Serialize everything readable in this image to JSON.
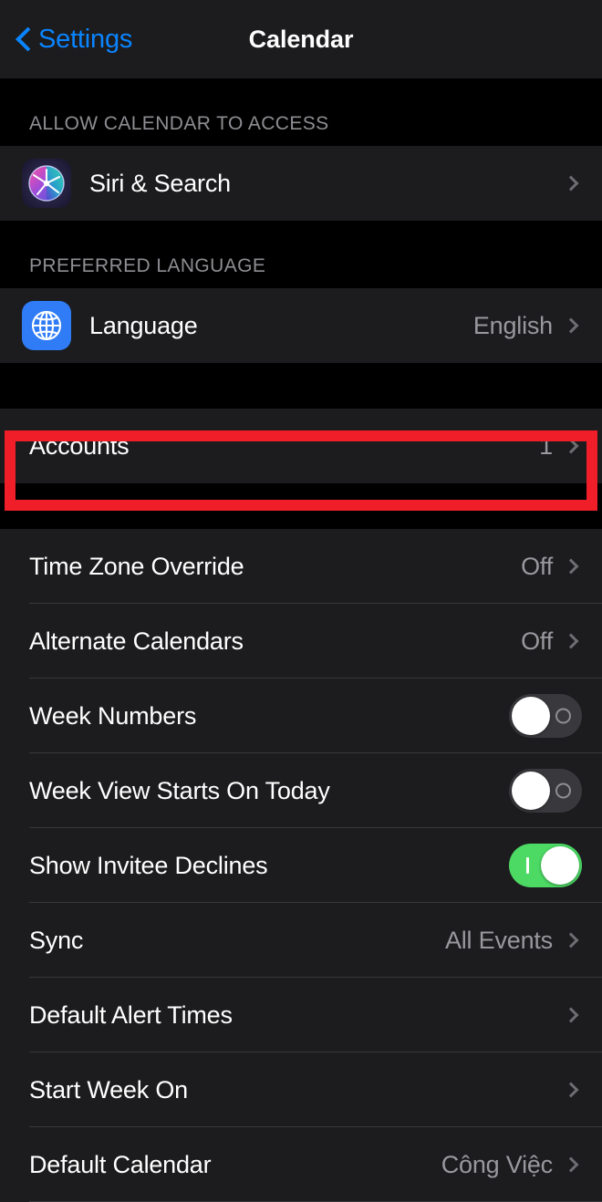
{
  "navbar": {
    "back_label": "Settings",
    "title": "Calendar",
    "back_icon": "chevron-left-icon",
    "accent_color": "#0A84FF"
  },
  "sections": [
    {
      "header": "ALLOW CALENDAR TO ACCESS",
      "rows": [
        {
          "label": "Siri & Search",
          "value": "",
          "icon": "siri-icon",
          "accessory": "chevron"
        }
      ]
    },
    {
      "header": "PREFERRED LANGUAGE",
      "rows": [
        {
          "label": "Language",
          "value": "English",
          "icon": "globe-icon",
          "accessory": "chevron"
        }
      ]
    },
    {
      "header": "",
      "highlighted": true,
      "rows": [
        {
          "label": "Accounts",
          "value": "1",
          "icon": "",
          "accessory": "chevron"
        }
      ]
    },
    {
      "header": "",
      "rows": [
        {
          "label": "Time Zone Override",
          "value": "Off",
          "icon": "",
          "accessory": "chevron"
        },
        {
          "label": "Alternate Calendars",
          "value": "Off",
          "icon": "",
          "accessory": "chevron"
        },
        {
          "label": "Week Numbers",
          "value": "",
          "icon": "",
          "accessory": "toggle",
          "toggle_on": false
        },
        {
          "label": "Week View Starts On Today",
          "value": "",
          "icon": "",
          "accessory": "toggle",
          "toggle_on": false
        },
        {
          "label": "Show Invitee Declines",
          "value": "",
          "icon": "",
          "accessory": "toggle",
          "toggle_on": true
        },
        {
          "label": "Sync",
          "value": "All Events",
          "icon": "",
          "accessory": "chevron"
        },
        {
          "label": "Default Alert Times",
          "value": "",
          "icon": "",
          "accessory": "chevron"
        },
        {
          "label": "Start Week On",
          "value": "",
          "icon": "",
          "accessory": "chevron"
        },
        {
          "label": "Default Calendar",
          "value": "Công Việc",
          "icon": "",
          "accessory": "chevron"
        }
      ]
    }
  ],
  "annotation": {
    "target": "Accounts",
    "color": "#F01E28"
  },
  "colors": {
    "background": "#000000",
    "row_background": "#1C1C1E",
    "separator": "#38383A",
    "secondary_text": "#98989E",
    "header_text": "#8E8E93",
    "toggle_on": "#4CD964",
    "toggle_off": "#39393D"
  }
}
